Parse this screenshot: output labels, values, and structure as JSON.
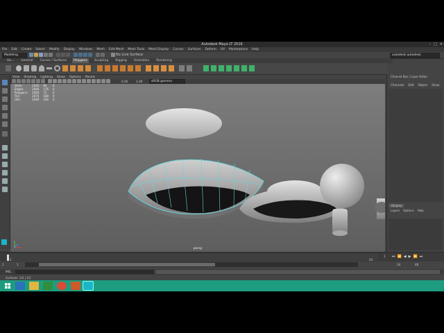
{
  "window": {
    "title": "Autodesk Maya LT 2016",
    "controls": [
      "–",
      "□",
      "✕"
    ]
  },
  "menubar": {
    "items": [
      "File",
      "Edit",
      "Create",
      "Select",
      "Modify",
      "Display",
      "Windows",
      "Mesh",
      "Edit Mesh",
      "Mesh Tools",
      "Mesh Display",
      "Curves",
      "Surfaces",
      "Deform",
      "UV",
      "Marketplace",
      "Help"
    ]
  },
  "statusline": {
    "mode": "Modeling",
    "live_surface": "No Live Surface",
    "account": "autodesk autodesk"
  },
  "shelf": {
    "tabs": [
      "Curves / Surfaces",
      "Polygons",
      "Sculpting",
      "Rigging",
      "Animation",
      "Rendering"
    ],
    "prefix_tabs": [
      "Ge...",
      "General"
    ],
    "active_tab": "Polygons"
  },
  "viewport": {
    "menu": [
      "View",
      "Shading",
      "Lighting",
      "Show",
      "Options",
      "Panels"
    ],
    "gamma": "sRGB gamma",
    "num_a": "0.00",
    "num_b": "1.00",
    "camera": "persp",
    "hud": {
      "rows": [
        {
          "label": "Verts:",
          "a": "1020",
          "b": "84",
          "c": "0"
        },
        {
          "label": "Edges:",
          "a": "2040",
          "b": "176",
          "c": "0"
        },
        {
          "label": "Polygons:",
          "a": "1004",
          "b": "72",
          "c": "0"
        },
        {
          "label": "Tris:",
          "a": "2070",
          "b": "188",
          "c": "0"
        },
        {
          "label": "UVs:",
          "a": "2049",
          "b": "104",
          "c": "0"
        }
      ]
    }
  },
  "channel_box": {
    "title": "Channel Box / Layer Editor",
    "menu": [
      "Channels",
      "Edit",
      "Object",
      "Show"
    ],
    "layer_tab": "Display",
    "layer_menu": [
      "Layers",
      "Options",
      "Help"
    ]
  },
  "timeline": {
    "start": "1",
    "end": "24",
    "range_start": "1",
    "range_end": "1",
    "playback_end": "24",
    "anim_end": "48",
    "current": "1"
  },
  "cmd": {
    "label": "MEL"
  },
  "helpline": {
    "text": "Surfaces: 1/2 | 1/1"
  },
  "colors": {
    "taskbar": "#1e9c7f",
    "selection": "#67d6e0",
    "maya_bg": "#444444"
  }
}
